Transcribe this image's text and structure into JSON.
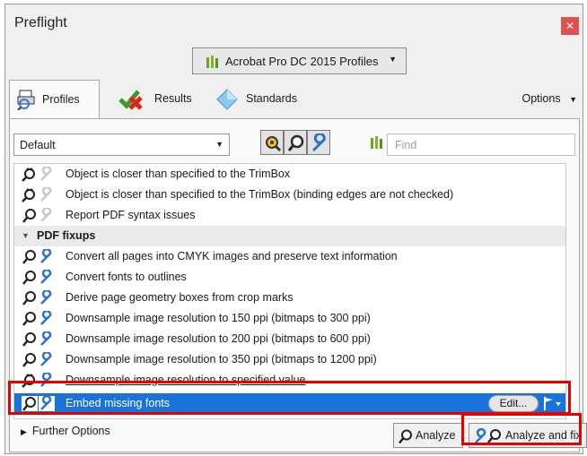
{
  "window": {
    "title": "Preflight",
    "close_icon": "close-icon"
  },
  "profile_dropdown": {
    "label": "Acrobat Pro DC 2015 Profiles"
  },
  "tabs": [
    {
      "label": "Profiles",
      "icon": "profiles-icon"
    },
    {
      "label": "Results",
      "icon": "results-icon"
    },
    {
      "label": "Standards",
      "icon": "standards-icon"
    }
  ],
  "options_label": "Options",
  "filter": {
    "selected": "Default",
    "find_placeholder": "Find"
  },
  "list": {
    "rows": [
      {
        "text": "Object is closer than specified to the TrimBox",
        "type": "check-editable"
      },
      {
        "text": "Object is closer than specified to the TrimBox (binding edges are not checked)",
        "type": "check-editable"
      },
      {
        "text": "Report PDF syntax issues",
        "type": "check"
      },
      {
        "text": "PDF fixups",
        "type": "group"
      },
      {
        "text": "Convert all pages into CMYK images and preserve text information",
        "type": "fixup"
      },
      {
        "text": "Convert fonts to outlines",
        "type": "fixup"
      },
      {
        "text": "Derive page geometry boxes from crop marks",
        "type": "fixup"
      },
      {
        "text": "Downsample image resolution to 150 ppi (bitmaps to 300 ppi)",
        "type": "fixup"
      },
      {
        "text": "Downsample image resolution to 200 ppi (bitmaps to 600 ppi)",
        "type": "fixup"
      },
      {
        "text": "Downsample image resolution to 350 ppi (bitmaps to 1200 ppi)",
        "type": "fixup"
      },
      {
        "text": "Downsample image resolution to specified value",
        "type": "fixup-editable"
      },
      {
        "text": "Embed missing fonts",
        "type": "fixup-selected"
      }
    ],
    "edit_label": "Edit..."
  },
  "further_options": "Further Options",
  "buttons": {
    "analyze": "Analyze",
    "analyze_fix": "Analyze and fix"
  },
  "colors": {
    "selection": "#1a73d9",
    "highlight": "#e60000",
    "close": "#e0514e"
  }
}
